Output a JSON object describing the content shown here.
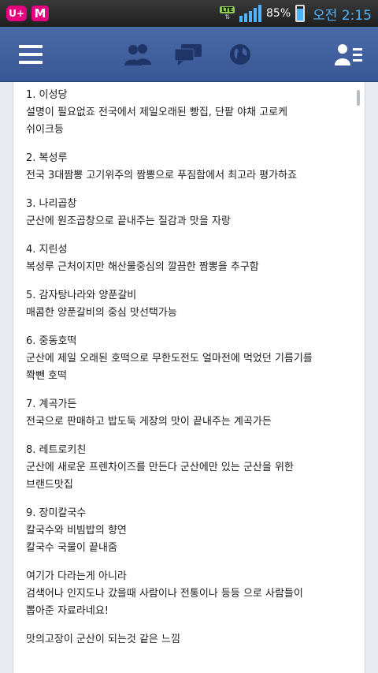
{
  "status_bar": {
    "carrier_badge": "U+",
    "app_badge": "M",
    "network": "LTE",
    "battery_percent": "85%",
    "battery_level": 0.85,
    "time": "오전 2:15"
  },
  "app_bar": {
    "icons": [
      "menu-icon",
      "friends-icon",
      "messages-icon",
      "globe-icon",
      "profile-list-icon"
    ],
    "accent": "#3b5998"
  },
  "post": {
    "paragraphs": [
      [
        "1. 이성당",
        "설명이 필요없죠 전국에서 제일오래된 빵집, 단팥 야채 고로케",
        "쉬이크등"
      ],
      [
        "2. 복성루",
        "전국 3대짬뽕 고기위주의 짬뽕으로 푸짐함에서 최고라 평가하죠"
      ],
      [
        "3. 나리곱창",
        "군산에 원조곱창으로 끝내주는 질감과 맛을 자랑"
      ],
      [
        "4. 지린성",
        "복성루 근처이지만 해산물중심의 깔끔한 짬뽕을 추구함"
      ],
      [
        "5. 감자탕나라와 양푼갈비",
        "매콤한 양푼갈비의 중심 맛선택가능"
      ],
      [
        "6. 중동호떡",
        "군산에 제일 오래된 호떡으로 무한도전도 얼마전에 먹었던 기름기를",
        "쫙뺀 호떡"
      ],
      [
        "7. 계곡가든",
        "전국으로 판매하고 밥도둑 게장의 맛이 끝내주는 계곡가든"
      ],
      [
        "8. 레트로키친",
        "군산에 새로운 프렌차이즈를 만든다 군산에만 있는 군산을 위한",
        "브랜드맛집"
      ],
      [
        "9. 장미칼국수",
        "칼국수와 비빔밥의 향연",
        "칼국수 국물이 끝내줌"
      ],
      [
        "여기가 다라는게 아니라",
        "검색어나 인지도나 갔을때 사람이나 전통이나 등등 으로 사람들이",
        "뽑아준 자료라네요!"
      ],
      [
        "맛의고장이 군산이 되는것 같은 느낌"
      ]
    ]
  }
}
